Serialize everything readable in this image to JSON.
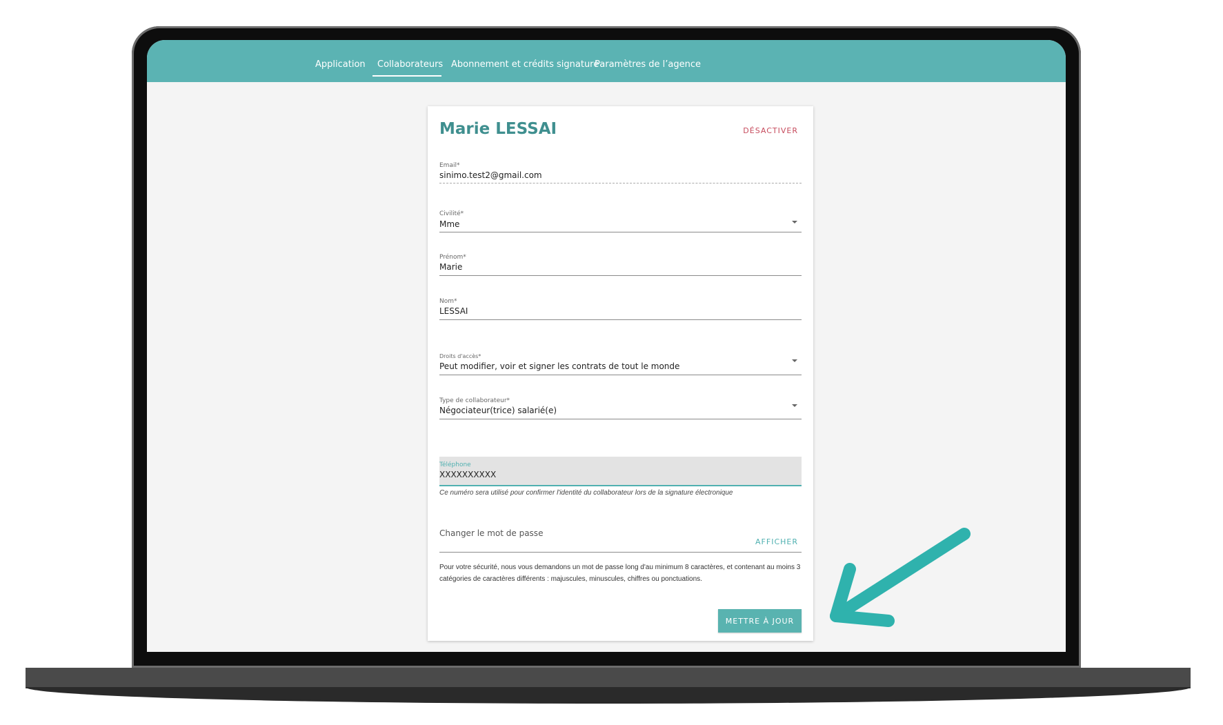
{
  "nav": {
    "tabs": [
      "Application",
      "Collaborateurs",
      "Abonnement et crédits signature",
      "Paramètres de l’agence"
    ],
    "active_tab": "Collaborateurs"
  },
  "card": {
    "title": "Marie LESSAI",
    "deactivate_label": "DÉSACTIVER"
  },
  "form": {
    "email": {
      "label": "Email*",
      "value": "sinimo.test2@gmail.com"
    },
    "civilite": {
      "label": "Civilité*",
      "value": "Mme"
    },
    "prenom": {
      "label": "Prénom*",
      "value": "Marie"
    },
    "nom": {
      "label": "Nom*",
      "value": "LESSAI"
    },
    "droits": {
      "label": "Droits d'accès*",
      "value": "Peut modifier, voir et signer les contrats de tout le monde"
    },
    "type": {
      "label": "Type de collaborateur*",
      "value": "Négociateur(trice) salarié(e)"
    },
    "telephone": {
      "label": "Téléphone",
      "value": "XXXXXXXXXX",
      "helper": "Ce numéro sera utilisé pour confirmer l'identité du collaborateur lors de la signature électronique"
    },
    "password": {
      "placeholder": "Changer le mot de passe",
      "toggle_label": "AFFICHER",
      "hint": "Pour votre sécurité, nous vous demandons un mot de passe long d'au minimum 8 caractères, et contenant au moins 3 catégories de caractères différents : majuscules, minuscules, chiffres ou ponctuations."
    },
    "submit_label": "METTRE À JOUR"
  },
  "colors": {
    "nav": "#5bb3b3",
    "title": "#3f8f8f",
    "deactivate": "#c64a5c",
    "button": "#59b3b0",
    "arrow": "#2fb2ad"
  }
}
